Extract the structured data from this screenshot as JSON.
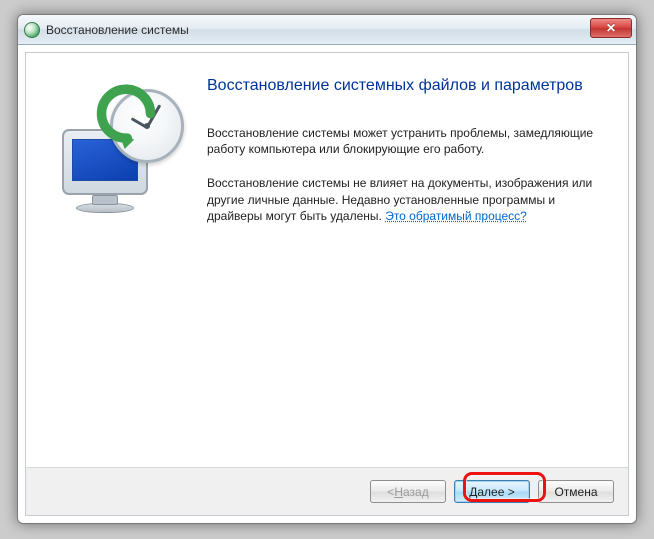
{
  "window": {
    "title": "Восстановление системы"
  },
  "content": {
    "heading": "Восстановление системных файлов и параметров",
    "para1": "Восстановление системы может устранить проблемы, замедляющие работу компьютера или блокирующие его работу.",
    "para2_a": "Восстановление системы не влияет на документы, изображения или другие личные данные. Недавно установленные программы и драйверы могут быть удалены. ",
    "link": "Это обратимый процесс?"
  },
  "buttons": {
    "back_prefix": "< ",
    "back_u": "Н",
    "back_rest": "азад",
    "next_u": "Д",
    "next_rest": "алее >",
    "cancel": "Отмена"
  }
}
